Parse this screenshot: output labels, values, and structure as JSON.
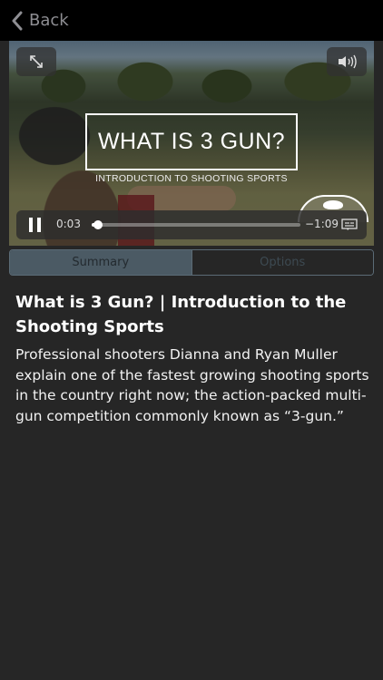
{
  "nav": {
    "back_label": "Back",
    "back_icon": "chevron-left-icon"
  },
  "video": {
    "title_card": "WHAT IS 3 GUN?",
    "subtitle_card": "INTRODUCTION TO SHOOTING SPORTS",
    "time_elapsed": "0:03",
    "time_remaining": "−1:09",
    "progress": 0.03,
    "icons": {
      "fullscreen": "expand-arrows-icon",
      "volume": "speaker-volume-icon",
      "pause": "pause-icon",
      "captions": "captions-icon"
    }
  },
  "tabs": {
    "summary": "Summary",
    "options": "Options",
    "selected": "Summary"
  },
  "article": {
    "title": "What is 3 Gun? | Introduction to the Shooting Sports",
    "body": "Professional shooters Dianna and Ryan Muller explain one of the fastest growing shooting sports in the country right now; the action-packed multi-gun competition commonly known as “3-gun.”"
  },
  "colors": {
    "background": "#262626",
    "nav_background": "#000000",
    "tab_selected": "#4b5a64",
    "tab_border": "#5b6b76"
  }
}
